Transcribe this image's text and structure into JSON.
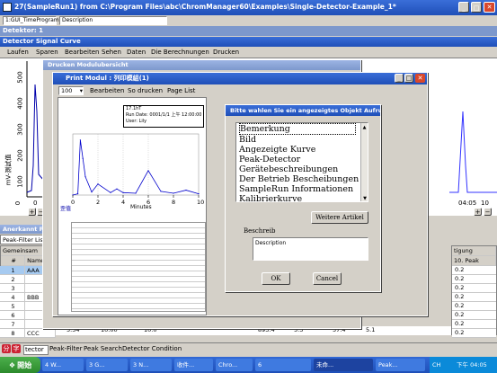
{
  "window": {
    "title": "27(SampleRun1) from C:\\Program Files\\abc\\ChromManager60\\Examples\\Single-Detector-Example_1*"
  },
  "toolbar": {
    "run_combo": "1:GUI_TimeProgram",
    "desc_combo": "Description"
  },
  "detector": {
    "label": "Detektor: 1",
    "signal_title": "Detector Signal Curve"
  },
  "main_menu": [
    "Laufen",
    "Sparen",
    "Bearbeiten",
    "Sehen",
    "Daten",
    "Die Berechnungen",
    "Drucken"
  ],
  "left_axis": {
    "ticks": [
      "500",
      "400",
      "300",
      "200",
      "100",
      "0"
    ],
    "label": "mV-測試值"
  },
  "bottom_axis": {
    "ticks": [
      "0",
      "10"
    ]
  },
  "peak_panel": {
    "title": "Anerkannt Peak-C",
    "tab": "Peak-Filter Lis",
    "header_label": "Gemeinsam",
    "col_hash": "#",
    "col_name": "Name",
    "rows": [
      {
        "n": "1",
        "name": "AAA"
      },
      {
        "n": "2",
        "name": ""
      },
      {
        "n": "3",
        "name": ""
      },
      {
        "n": "4",
        "name": "BBB"
      },
      {
        "n": "5",
        "name": ""
      },
      {
        "n": "6",
        "name": ""
      },
      {
        "n": "7",
        "name": ""
      },
      {
        "n": "8",
        "name": "CCC"
      }
    ],
    "last_row_vals": [
      "5.54",
      "10.00",
      "10.0",
      "893.4",
      "5.5",
      "57.4",
      "5.1"
    ]
  },
  "right_panel": {
    "col1": "tigung",
    "col2": "10. Peak",
    "values": [
      "0.2",
      "0.2",
      "0.2",
      "0.2",
      "0.2",
      "0.2",
      "0.2",
      "0.2"
    ]
  },
  "right_axis": {
    "ticks": [
      "04:05",
      "10"
    ]
  },
  "bottom_tabs": [
    "tector",
    "Peak-Filter",
    "Peak Search",
    "Detector Condition"
  ],
  "bottom_icons": [
    "分",
    "字"
  ],
  "druck_window": {
    "title": "Drucken Modulubersicht"
  },
  "print_modul": {
    "title": "Print Modul : 列印模組(1)",
    "zoom": "100",
    "menu": [
      "Bearbeiten",
      "So drucken",
      "Page List"
    ],
    "page_header": [
      "17.1hT",
      "Run Date: 0001/1/1 上午 12:00:00",
      "User: Lily"
    ],
    "chart_xticks": [
      "0",
      "2",
      "4",
      "6",
      "8",
      "10"
    ],
    "chart_xlabel": "Minutes",
    "chart_ylabel": "歪值"
  },
  "chart_data": {
    "type": "line",
    "title": "",
    "xlabel": "Minutes",
    "ylabel": "",
    "xlim": [
      0,
      10
    ],
    "x": [
      0,
      0.4,
      0.6,
      0.8,
      1,
      1.5,
      2,
      3,
      3.5,
      4,
      5,
      6,
      7,
      8,
      9,
      10
    ],
    "series": [
      {
        "name": "",
        "values": [
          0,
          2,
          90,
          60,
          30,
          5,
          18,
          4,
          10,
          4,
          3,
          40,
          6,
          3,
          8,
          2
        ]
      }
    ]
  },
  "dialog": {
    "title": "Bitte wahlen Sie ein angezeigtes Objekt Aufruf",
    "items": [
      "Bemerkung",
      "Bild",
      "Angezeigte Kurve",
      "Peak-Detector",
      "Gerätebeschreibungen",
      "Der Betrieb Bescheibungen",
      "SampleRun Informationen",
      "Kalibrierkurve"
    ],
    "more_button": "Weitere Artikel",
    "desc_label": "Beschreib",
    "desc_value": "Description",
    "ok": "OK",
    "cancel": "Cancel"
  },
  "taskbar": {
    "start": "開始",
    "tasks": [
      "4 W...",
      "3 G...",
      "3 N...",
      "收件...",
      "Chro...",
      "6",
      "未命...",
      "Peak..."
    ],
    "clock": "下午 04:05",
    "lang": "CH"
  }
}
